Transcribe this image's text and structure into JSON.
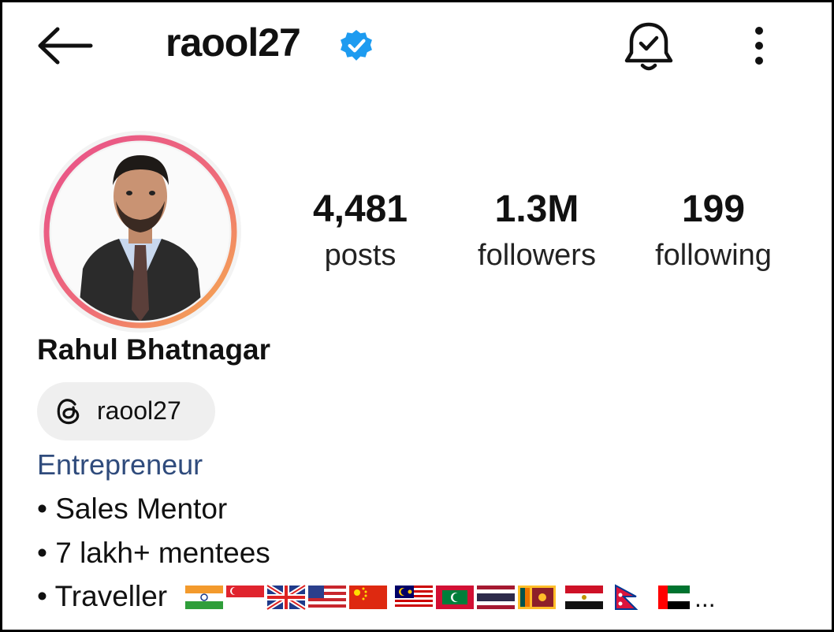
{
  "header": {
    "back_icon": "arrow-left-icon",
    "username": "raool27",
    "verified_icon": "verified-badge-icon",
    "notifications_icon": "bell-check-icon",
    "more_icon": "more-vertical-icon"
  },
  "profile": {
    "full_name": "Rahul Bhatnagar",
    "threads": {
      "icon": "threads-icon",
      "handle": "raool27"
    },
    "category": "Entrepreneur",
    "bio": [
      "• Sales Mentor",
      "• 7 lakh+ mentees",
      "• Traveller"
    ],
    "bio_ellipsis": "...",
    "travel_flags": [
      "India",
      "Singapore",
      "United Kingdom",
      "United States",
      "China",
      "Malaysia",
      "Maldives",
      "Thailand",
      "Sri Lanka",
      "Egypt",
      "Nepal",
      "United Arab Emirates"
    ]
  },
  "stats": {
    "posts": {
      "value": "4,481",
      "label": "posts"
    },
    "followers": {
      "value": "1.3M",
      "label": "followers"
    },
    "following": {
      "value": "199",
      "label": "following"
    }
  },
  "colors": {
    "verified_blue": "#1d9bf0",
    "category_link": "#2f4b7c",
    "chip_bg": "#efefef",
    "story_ring_pink": "#e8528a",
    "story_ring_orange": "#f6b04a"
  }
}
